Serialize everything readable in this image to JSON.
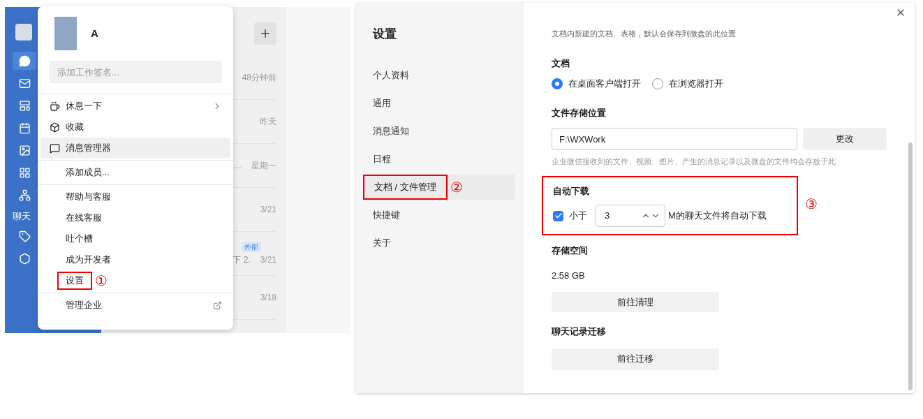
{
  "sidebar": {
    "label": "聊天",
    "items": [
      {
        "selected": true
      },
      {
        "selected": false
      },
      {
        "selected": false
      },
      {
        "selected": false
      },
      {
        "selected": false
      },
      {
        "selected": false
      },
      {
        "selected": false
      }
    ],
    "extra_items": [
      {
        "selected": false
      },
      {
        "selected": false
      }
    ]
  },
  "chat_list": {
    "rows": [
      {
        "time": "48分钟前"
      },
      {
        "time": "昨天"
      },
      {
        "time": "星期一",
        "preview": "…"
      },
      {
        "time": "3/21"
      },
      {
        "time": "3/21",
        "preview": "下 2.",
        "badge": "外部"
      },
      {
        "time": "3/18"
      }
    ]
  },
  "menu": {
    "user": {
      "name": "A"
    },
    "signature": {
      "placeholder": "添加工作签名..."
    },
    "groups": [
      [
        {
          "label": "休息一下",
          "kind": "submenu",
          "selected": false
        },
        {
          "label": "收藏",
          "kind": "plain",
          "selected": false
        },
        {
          "label": "消息管理器",
          "kind": "plain",
          "selected": true
        }
      ],
      [
        {
          "label": "添加成员...",
          "kind": "plain",
          "selected": false
        }
      ],
      [
        {
          "label": "帮助与客服",
          "kind": "plain",
          "selected": false
        },
        {
          "label": "在线客服",
          "kind": "plain",
          "selected": false
        },
        {
          "label": "吐个槽",
          "kind": "plain",
          "selected": false
        },
        {
          "label": "成为开发者",
          "kind": "plain",
          "selected": false
        },
        {
          "label": "设置",
          "kind": "plain",
          "selected": false,
          "marker": "①"
        }
      ],
      [
        {
          "label": "管理企业",
          "kind": "external",
          "selected": false
        }
      ]
    ]
  },
  "settings": {
    "title": "设置",
    "nav": [
      {
        "label": "个人资料",
        "selected": false
      },
      {
        "label": "通用",
        "selected": false
      },
      {
        "label": "消息通知",
        "selected": false
      },
      {
        "label": "日程",
        "selected": false
      },
      {
        "label": "文档 / 文件管理",
        "selected": true,
        "marker": "②"
      },
      {
        "label": "快捷键",
        "selected": false
      },
      {
        "label": "关于",
        "selected": false
      }
    ],
    "note": "文档内新建的文档、表格，默认会保存到微盘的此位置",
    "document": {
      "heading": "文档",
      "options": [
        {
          "label": "在桌面客户端打开",
          "selected": true
        },
        {
          "label": "在浏览器打开",
          "selected": false
        }
      ]
    },
    "storage_location": {
      "heading": "文件存储位置",
      "path": "F:\\WXWork",
      "button": "更改",
      "hint": "企业微信接收到的文件、视频、图片、产生的消息记录以及微盘的文件均会存放于此"
    },
    "auto_download": {
      "heading": "自动下载",
      "marker": "③",
      "checked": true,
      "label": "小于",
      "value": "3",
      "suffix": "M的聊天文件将自动下载"
    },
    "storage_space": {
      "heading": "存储空间",
      "size": "2.58 GB",
      "button": "前往清理"
    },
    "migration": {
      "heading": "聊天记录迁移",
      "button": "前往迁移"
    }
  }
}
